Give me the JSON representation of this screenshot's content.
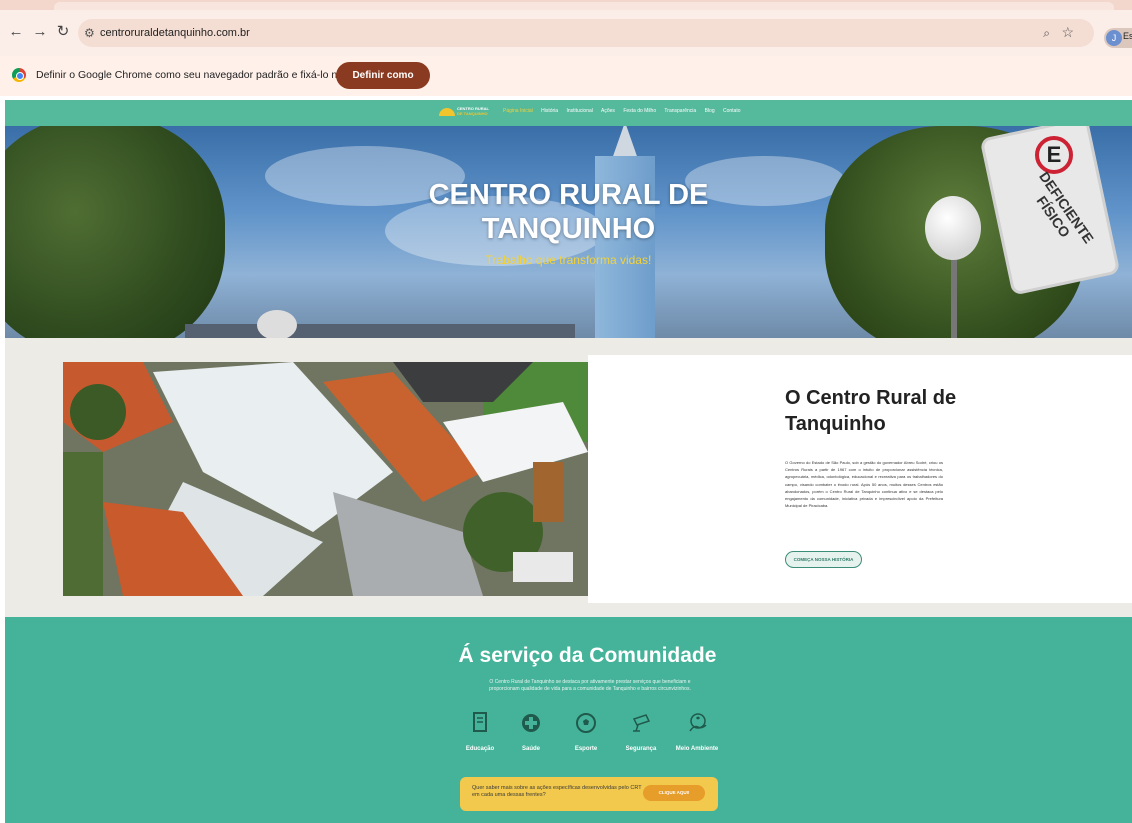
{
  "browser": {
    "url": "centroruraldetanquinho.com.br",
    "profile_initial": "J",
    "profile_text": "Es",
    "infobar_text": "Definir o Google Chrome como seu navegador padrão e fixá-lo na barra de tarefas",
    "infobar_button": "Definir como padrão"
  },
  "site": {
    "logo_line1": "CENTRO RURAL",
    "logo_line2": "DE TANQUINHO",
    "nav": [
      "Página Inicial",
      "História",
      "Institucional",
      "Ações",
      "Festa do Milho",
      "Transparência",
      "Blog",
      "Contato"
    ],
    "nav_active_index": 0,
    "hero": {
      "title_line1": "CENTRO RURAL DE",
      "title_line2": "TANQUINHO",
      "subtitle": "Trabalho que transforma vidas!",
      "sign_letter": "E",
      "sign_text": "DEFICIENTE FÍSICO"
    },
    "about": {
      "title": "O Centro Rural de Tanquinho",
      "text": "O Governo do Estado de São Paulo, sob a gestão do governador Abreu Sodré, criou os Centros Rurais a partir de 1967 com o intuito de proporcionar assistência técnica, agropecuária, médica, odontológica, educacional e recreativa para os trabalhadores do campo, visando combater o êxodo rural. Após 50 anos, muitos desses Centros estão abandonados, porém o Centro Rural de Tanquinho continua ativo e se destaca pelo engajamento da comunidade, iniciativa privada e imprescindível apoio da Prefeitura Municipal de Piracicaba.",
      "button": "COMEÇA NOSSA HISTÓRIA"
    },
    "service": {
      "title": "Á serviço da Comunidade",
      "description": "O Centro Rural de Tanquinho se destaca por ativamente prestar serviços que beneficiam e proporcionam qualidade de vida para a comunidade de Tanquinho e bairros circunvizinhos.",
      "items": [
        {
          "label": "Educação",
          "icon": "book-icon"
        },
        {
          "label": "Saúde",
          "icon": "health-icon"
        },
        {
          "label": "Esporte",
          "icon": "soccer-ball-icon"
        },
        {
          "label": "Segurança",
          "icon": "security-camera-icon"
        },
        {
          "label": "Meio Ambiente",
          "icon": "environment-icon"
        }
      ],
      "cta_text": "Quer saber mais sobre as ações específicas desenvolvidas pelo CRT em cada uma dessas frentes?",
      "cta_button": "CLIQUE AQUI!"
    }
  },
  "colors": {
    "nav_green": "#55b99c",
    "service_green": "#45b39a",
    "accent_yellow": "#f2d23a",
    "cta_yellow": "#f2c94c",
    "infobar_button": "#8a3a20"
  }
}
